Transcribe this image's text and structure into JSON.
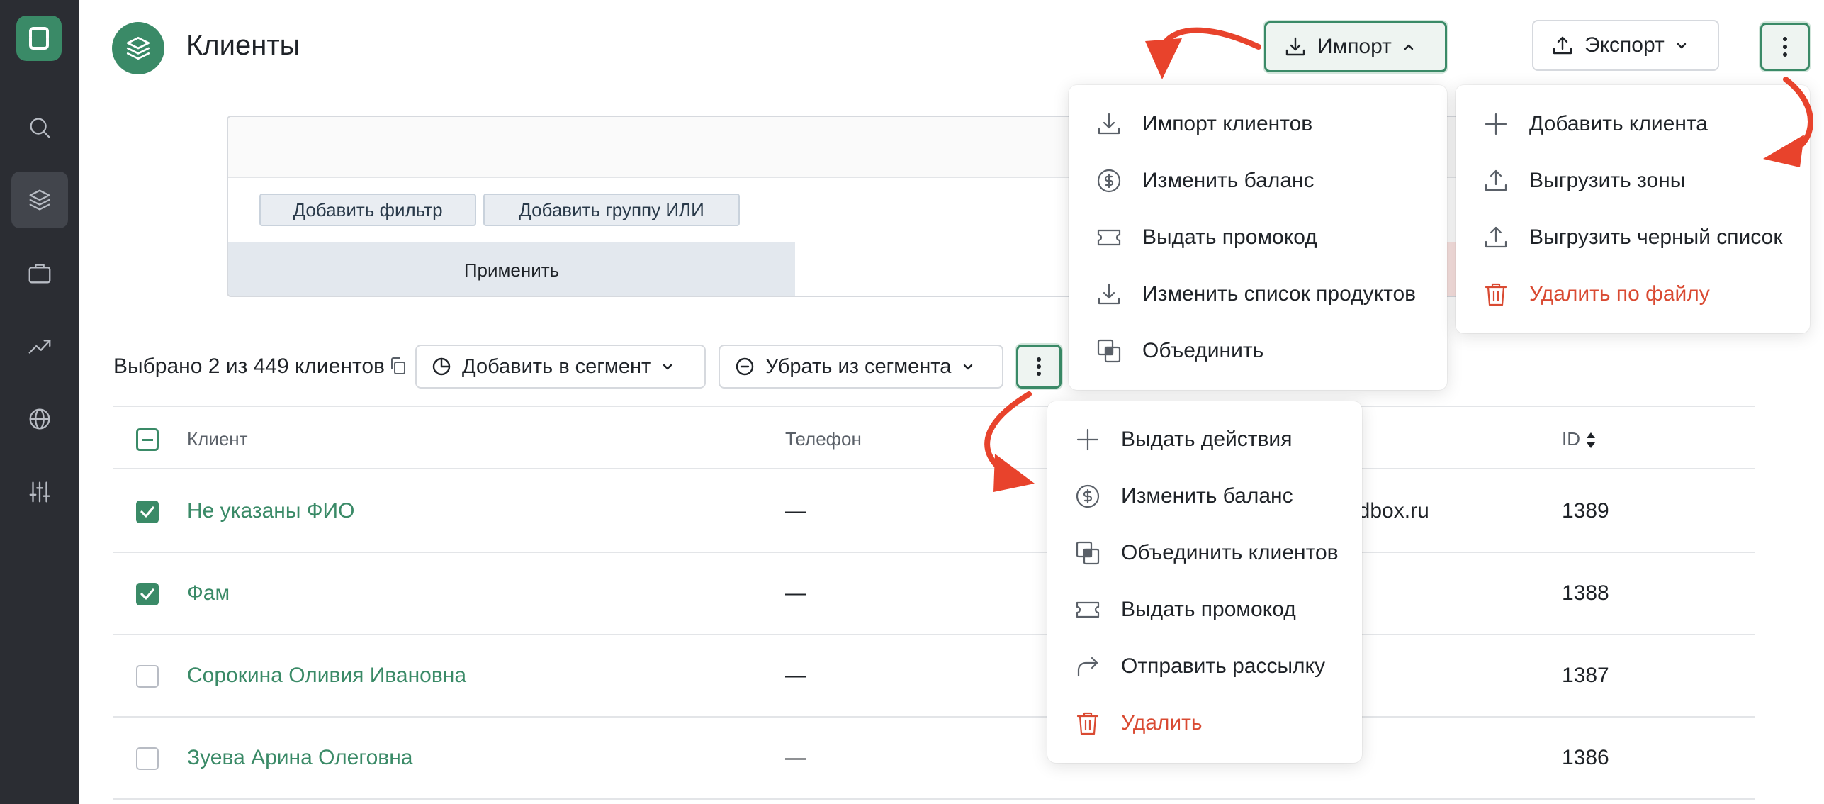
{
  "page": {
    "title": "Клиенты"
  },
  "header": {
    "import_label": "Импорт",
    "export_label": "Экспорт"
  },
  "filter": {
    "add_filter": "Добавить фильтр",
    "add_or_group": "Добавить группу ИЛИ",
    "apply": "Применить"
  },
  "toolbar": {
    "selected": "Выбрано 2 из 449 клиентов",
    "add_to_segment": "Добавить в сегмент",
    "remove_from_segment": "Убрать из сегмента"
  },
  "table": {
    "headers": {
      "client": "Клиент",
      "phone": "Телефон",
      "id": "ID"
    },
    "rows": [
      {
        "name": "Не указаны ФИО",
        "phone": "—",
        "email_fragment": "ndbox.ru",
        "id": "1389",
        "checked": true
      },
      {
        "name": "Фам",
        "phone": "—",
        "email_fragment": "",
        "id": "1388",
        "checked": true
      },
      {
        "name": "Сорокина Оливия Ивановна",
        "phone": "—",
        "email_fragment": "",
        "id": "1387",
        "checked": false
      },
      {
        "name": "Зуева Арина Олеговна",
        "phone": "—",
        "email_fragment": "",
        "id": "1386",
        "checked": false
      }
    ]
  },
  "import_menu": {
    "items": [
      {
        "label": "Импорт клиентов",
        "icon": "download-icon"
      },
      {
        "label": "Изменить баланс",
        "icon": "coin-icon"
      },
      {
        "label": "Выдать промокод",
        "icon": "ticket-icon"
      },
      {
        "label": "Изменить список продуктов",
        "icon": "download-icon"
      },
      {
        "label": "Объединить",
        "icon": "merge-icon"
      }
    ]
  },
  "more_menu": {
    "items": [
      {
        "label": "Добавить клиента",
        "icon": "plus-icon"
      },
      {
        "label": "Выгрузить зоны",
        "icon": "upload-icon"
      },
      {
        "label": "Выгрузить черный список",
        "icon": "upload-icon"
      },
      {
        "label": "Удалить по файлу",
        "icon": "trash-icon",
        "danger": true
      }
    ]
  },
  "bulk_menu": {
    "items": [
      {
        "label": "Выдать действия",
        "icon": "plus-icon"
      },
      {
        "label": "Изменить баланс",
        "icon": "coin-icon"
      },
      {
        "label": "Объединить клиентов",
        "icon": "merge-icon"
      },
      {
        "label": "Выдать промокод",
        "icon": "ticket-icon"
      },
      {
        "label": "Отправить рассылку",
        "icon": "share-icon"
      },
      {
        "label": "Удалить",
        "icon": "trash-icon",
        "danger": true
      }
    ]
  },
  "colors": {
    "brand": "#3a8a67",
    "danger": "#d94a32",
    "annotation_arrow": "#e8432c",
    "sidebar": "#2b2d33"
  }
}
